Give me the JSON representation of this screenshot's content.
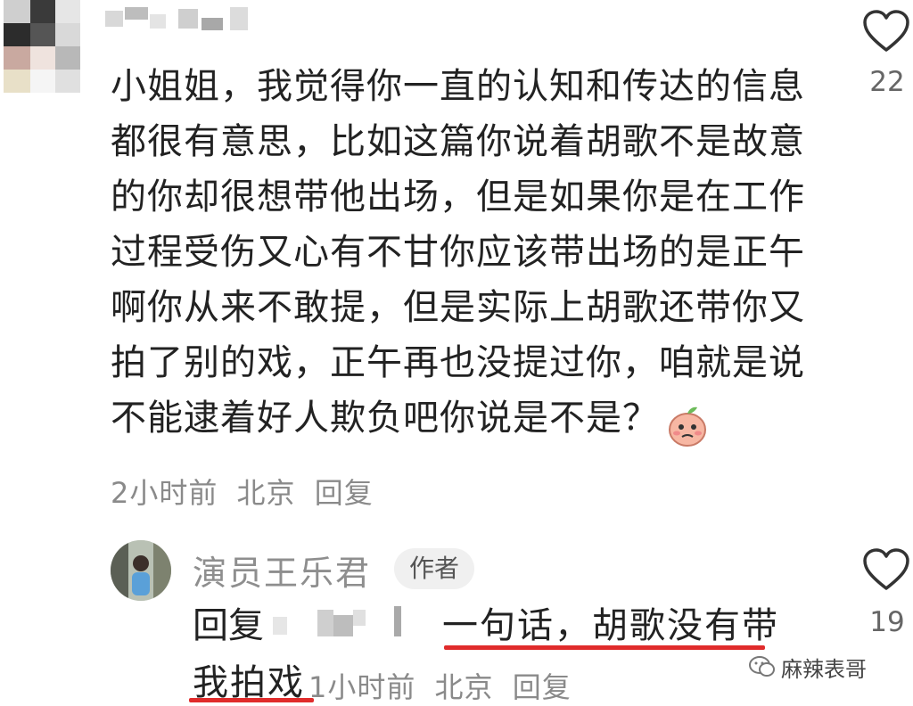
{
  "comment": {
    "text": "小姐姐，我觉得你一直的认知和传达的信息都很有意思，比如这篇你说着胡歌不是故意的你却很想带他出场，但是如果你是在工作过程受伤又心有不甘你应该带出场的是正午啊你从来不敢提，但是实际上胡歌还带你又拍了别的戏，正午再也没提过你，咱就是说不能逮着好人欺负吧你说是不是？",
    "likes": "22",
    "time": "2小时前",
    "location": "北京",
    "reply_label": "回复"
  },
  "reply": {
    "author": "演员王乐君",
    "badge": "作者",
    "prefix": "回复",
    "message_line1": "一句话，胡歌没有带",
    "message_line2": "我拍戏",
    "likes": "19",
    "time": "1小时前",
    "location": "北京",
    "reply_label": "回复"
  },
  "watermark": "麻辣表哥",
  "icons": {
    "like": "heart-outline-icon",
    "emoji": "peach-face-emoji-icon",
    "watermark_logo": "wechat-icon"
  },
  "colors": {
    "highlight_underline": "#e02b2b",
    "meta_gray": "#8a8a8a"
  }
}
